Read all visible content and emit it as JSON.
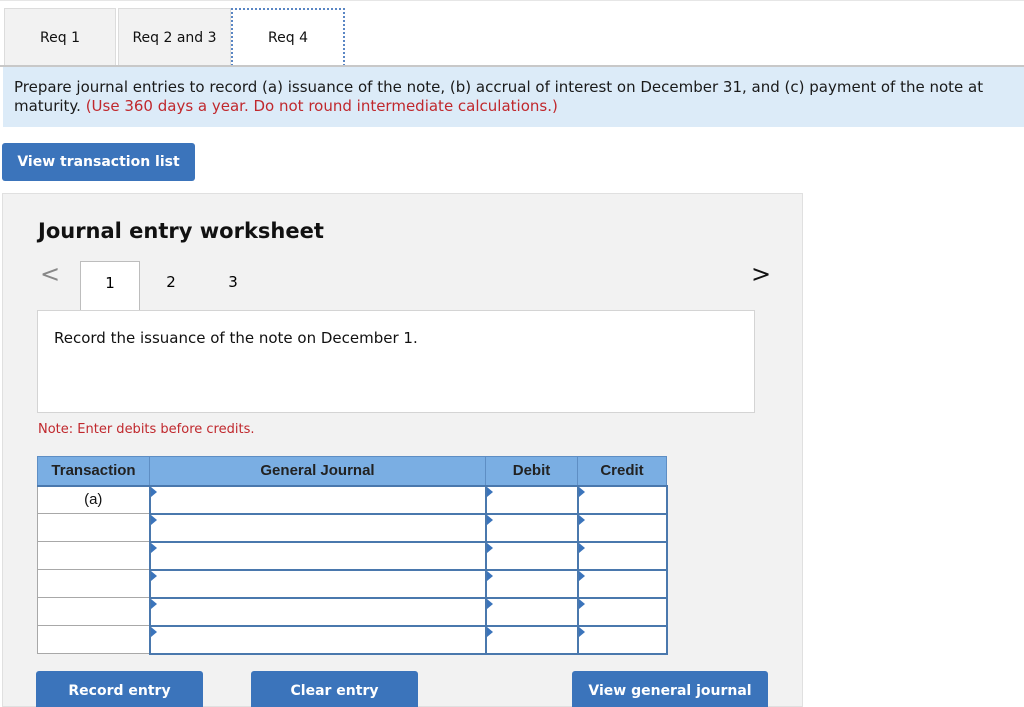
{
  "tabs": [
    {
      "label": "Req 1",
      "active": false
    },
    {
      "label": "Req 2 and 3",
      "active": false
    },
    {
      "label": "Req 4",
      "active": true
    }
  ],
  "instructions": {
    "main": "Prepare journal entries to record (a) issuance of the note, (b) accrual of interest on December 31, and (c) payment of the note at maturity.",
    "line1": "Prepare journal entries to record (a) issuance of the note, (b) accrual of interest on December 31, and (c) payment of the note at",
    "line2_prefix": "maturity.",
    "note_red": "(Use 360 days a year. Do not round intermediate calculations.)"
  },
  "buttons": {
    "view_transaction_list": "View transaction list",
    "record_entry": "Record entry",
    "clear_entry": "Clear entry",
    "view_general_journal": "View general journal"
  },
  "worksheet": {
    "title": "Journal entry worksheet",
    "nav_prev": "<",
    "nav_next": ">",
    "steps": [
      "1",
      "2",
      "3"
    ],
    "active_step": "1",
    "prompt": "Record the issuance of the note on December 1.",
    "note": "Note: Enter debits before credits."
  },
  "journal": {
    "headers": [
      "Transaction",
      "General Journal",
      "Debit",
      "Credit"
    ],
    "rows": [
      {
        "transaction": "(a)",
        "account": "",
        "debit": "",
        "credit": ""
      },
      {
        "transaction": "",
        "account": "",
        "debit": "",
        "credit": ""
      },
      {
        "transaction": "",
        "account": "",
        "debit": "",
        "credit": ""
      },
      {
        "transaction": "",
        "account": "",
        "debit": "",
        "credit": ""
      },
      {
        "transaction": "",
        "account": "",
        "debit": "",
        "credit": ""
      },
      {
        "transaction": "",
        "account": "",
        "debit": "",
        "credit": ""
      }
    ]
  },
  "colors": {
    "accent_blue": "#3b74bb",
    "header_blue": "#7aaee3",
    "instruction_bg": "#dcebf8",
    "warning_red": "#c0282d"
  }
}
